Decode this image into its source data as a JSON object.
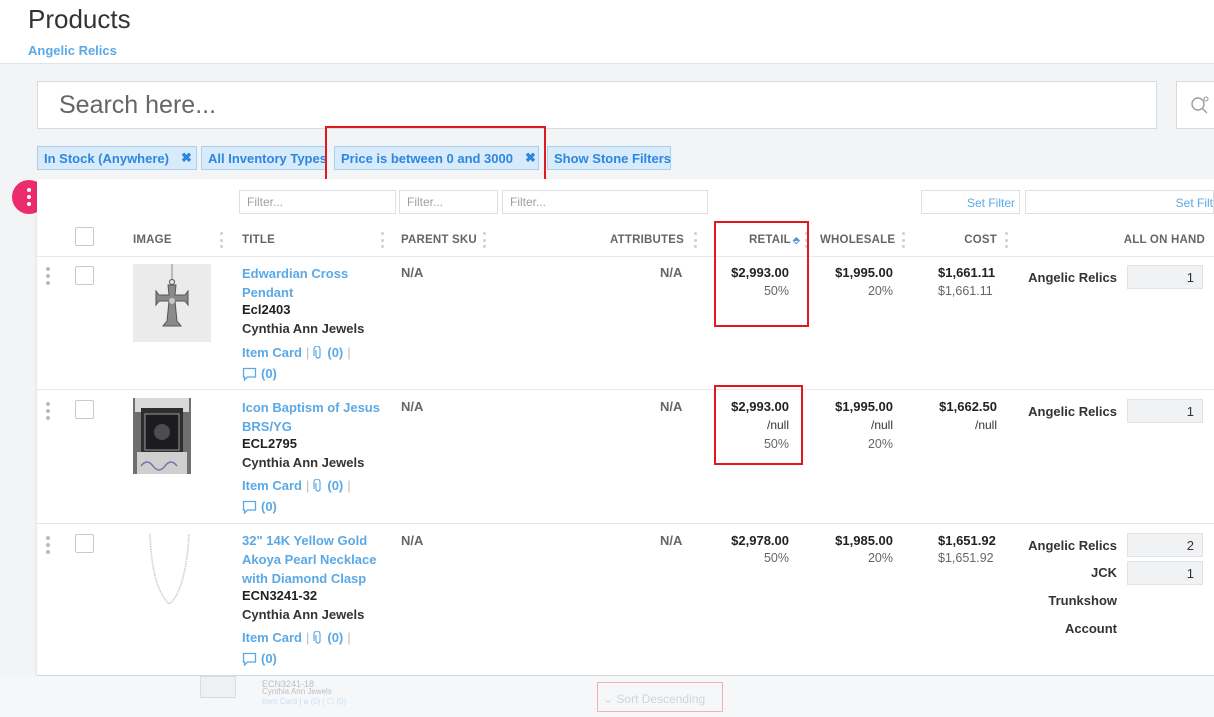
{
  "header": {
    "title": "Products",
    "subtitle": "Angelic Relics"
  },
  "search": {
    "placeholder": "Search here..."
  },
  "filters": {
    "chips": [
      {
        "label": "In Stock (Anywhere)",
        "removable": true
      },
      {
        "label": "All Inventory Types",
        "removable": false
      },
      {
        "label": "Price is between 0 and 3000",
        "removable": true
      },
      {
        "label": "Show Stone Filters",
        "removable": false
      }
    ],
    "remove_glyph": "✖",
    "column_filter_placeholder": "Filter...",
    "set_filter_label": "Set Filter",
    "set_filter_label_2": "Set Filt"
  },
  "table": {
    "columns": {
      "image": "IMAGE",
      "title": "TITLE",
      "parent_sku": "PARENT SKU",
      "attributes": "ATTRIBUTES",
      "retail": "RETAIL",
      "wholesale": "WHOLESALE",
      "cost": "COST",
      "all_on_hand": "ALL ON HAND"
    },
    "sort_column": "retail",
    "sort_icon": "⬘",
    "item_card_label": "Item Card",
    "rows": [
      {
        "title": "Edwardian Cross Pendant",
        "sku": "Ecl2403",
        "brand": "Cynthia Ann Jewels",
        "attachments": "(0)",
        "comments": "(0)",
        "parent_sku": "N/A",
        "attributes": "N/A",
        "retail": "$2,993.00",
        "retail_markup": "50%",
        "wholesale": "$1,995.00",
        "wholesale_markup": "20%",
        "cost": "$1,661.11",
        "cost_sub": "$1,661.11",
        "locations": [
          {
            "name": "Angelic Relics",
            "qty": "1"
          }
        ]
      },
      {
        "title": "Icon Baptism of Jesus BRS/YG",
        "sku": "ECL2795",
        "brand": "Cynthia Ann Jewels",
        "attachments": "(0)",
        "comments": "(0)",
        "parent_sku": "N/A",
        "attributes": "N/A",
        "retail": "$2,993.00",
        "retail_sub": "/null",
        "retail_markup": "50%",
        "wholesale": "$1,995.00",
        "wholesale_sub": "/null",
        "wholesale_markup": "20%",
        "cost": "$1,662.50",
        "cost_sub": "/null",
        "locations": [
          {
            "name": "Angelic Relics",
            "qty": "1"
          }
        ]
      },
      {
        "title": "32\" 14K Yellow Gold Akoya Pearl Necklace with Diamond Clasp",
        "sku": "ECN3241-32",
        "brand": "Cynthia Ann Jewels",
        "attachments": "(0)",
        "comments": "(0)",
        "parent_sku": "N/A",
        "attributes": "N/A",
        "retail": "$2,978.00",
        "retail_markup": "50%",
        "wholesale": "$1,985.00",
        "wholesale_markup": "20%",
        "cost": "$1,651.92",
        "cost_sub": "$1,651.92",
        "locations": [
          {
            "name": "Angelic Relics",
            "qty": "2"
          },
          {
            "name": "JCK",
            "qty": "1"
          },
          {
            "name": "Trunkshow",
            "qty": ""
          },
          {
            "name": "Account",
            "qty": ""
          }
        ]
      }
    ]
  },
  "ghost": {
    "sku": "ECN3241-18",
    "brand": "Cynthia Ann Jewels",
    "links": "Item Card | ⌀ (0) | ☐ (0)",
    "sort_option": "Sort Descending"
  }
}
